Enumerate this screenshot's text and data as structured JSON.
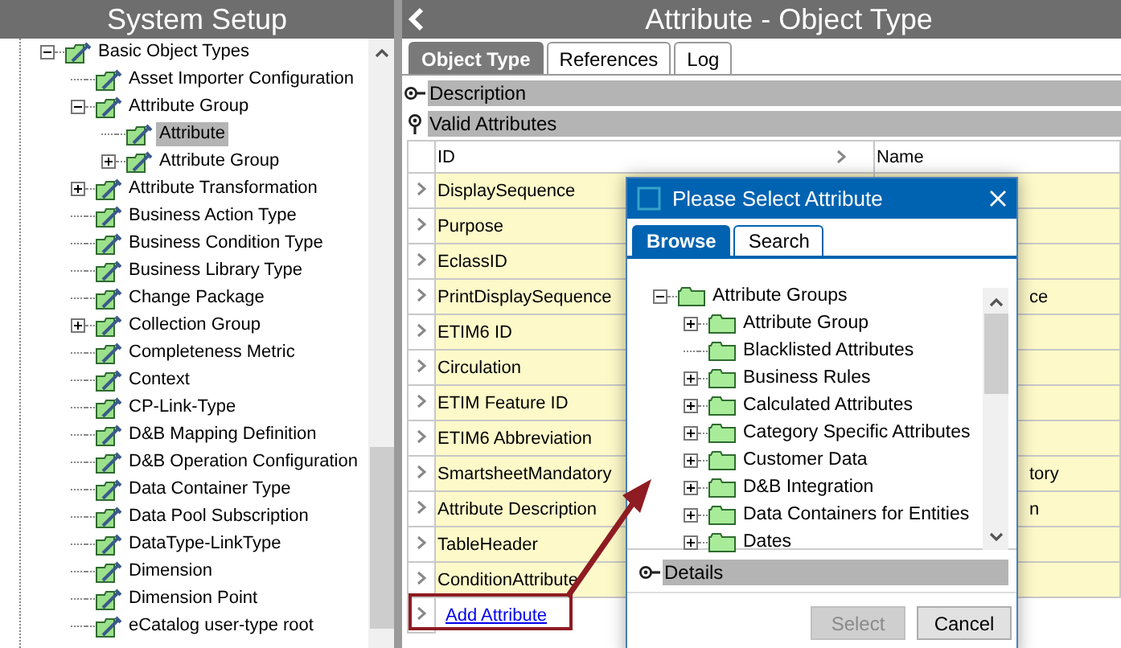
{
  "left_panel": {
    "title": "System Setup",
    "tree": [
      {
        "label": "Basic Object Types",
        "expanded": true,
        "selected": false,
        "children": [
          {
            "label": "Asset Importer Configuration",
            "selected": false
          },
          {
            "label": "Attribute Group",
            "expanded": true,
            "selected": false,
            "children": [
              {
                "label": "Attribute",
                "selected": true
              },
              {
                "label": "Attribute Group",
                "expanded": false,
                "selected": false
              }
            ]
          },
          {
            "label": "Attribute Transformation",
            "expanded": false,
            "selected": false
          },
          {
            "label": "Business Action Type",
            "selected": false
          },
          {
            "label": "Business Condition Type",
            "selected": false
          },
          {
            "label": "Business Library Type",
            "selected": false
          },
          {
            "label": "Change Package",
            "selected": false
          },
          {
            "label": "Collection Group",
            "expanded": false,
            "selected": false
          },
          {
            "label": "Completeness Metric",
            "selected": false
          },
          {
            "label": "Context",
            "selected": false
          },
          {
            "label": "CP-Link-Type",
            "selected": false
          },
          {
            "label": "D&B Mapping Definition",
            "selected": false
          },
          {
            "label": "D&B Operation Configuration",
            "selected": false
          },
          {
            "label": "Data Container Type",
            "selected": false
          },
          {
            "label": "Data Pool Subscription",
            "selected": false
          },
          {
            "label": "DataType-LinkType",
            "selected": false
          },
          {
            "label": "Dimension",
            "selected": false
          },
          {
            "label": "Dimension Point",
            "selected": false
          },
          {
            "label": "eCatalog user-type root",
            "selected": false
          }
        ]
      }
    ]
  },
  "main": {
    "title": "Attribute - Object Type",
    "tabs": [
      {
        "label": "Object Type",
        "selected": true
      },
      {
        "label": "References",
        "selected": false
      },
      {
        "label": "Log",
        "selected": false
      }
    ],
    "sections": [
      {
        "label": "Description",
        "expanded": false
      },
      {
        "label": "Valid Attributes",
        "expanded": true
      }
    ],
    "table": {
      "columns": [
        "ID",
        "Name"
      ],
      "rows": [
        {
          "id": "DisplaySequence"
        },
        {
          "id": "Purpose"
        },
        {
          "id": "EclassID"
        },
        {
          "id": "PrintDisplaySequence",
          "name": "ce"
        },
        {
          "id": "ETIM6 ID"
        },
        {
          "id": "Circulation"
        },
        {
          "id": "ETIM Feature ID"
        },
        {
          "id": "ETIM6 Abbreviation"
        },
        {
          "id": "SmartsheetMandatory",
          "name": "tory"
        },
        {
          "id": "Attribute Description",
          "name": "n"
        },
        {
          "id": "TableHeader"
        },
        {
          "id": "ConditionAttribute"
        }
      ],
      "add_link": "Add Attribute"
    }
  },
  "dialog": {
    "title": "Please Select Attribute",
    "tabs": [
      {
        "label": "Browse",
        "selected": true
      },
      {
        "label": "Search",
        "selected": false
      }
    ],
    "tree": [
      {
        "label": "Attribute Groups",
        "expanded": true,
        "children": [
          {
            "label": "Attribute Group",
            "expanded": false
          },
          {
            "label": "Blacklisted Attributes"
          },
          {
            "label": "Business Rules",
            "expanded": false
          },
          {
            "label": "Calculated Attributes",
            "expanded": false
          },
          {
            "label": "Category Specific Attributes",
            "expanded": false
          },
          {
            "label": "Customer Data",
            "expanded": false
          },
          {
            "label": "D&B Integration",
            "expanded": false
          },
          {
            "label": "Data Containers for Entities",
            "expanded": false
          },
          {
            "label": "Dates",
            "expanded": false
          }
        ]
      }
    ],
    "details": {
      "label": "Details",
      "expanded": false
    },
    "buttons": [
      {
        "label": "Select",
        "disabled": true
      },
      {
        "label": "Cancel",
        "disabled": false
      }
    ]
  }
}
